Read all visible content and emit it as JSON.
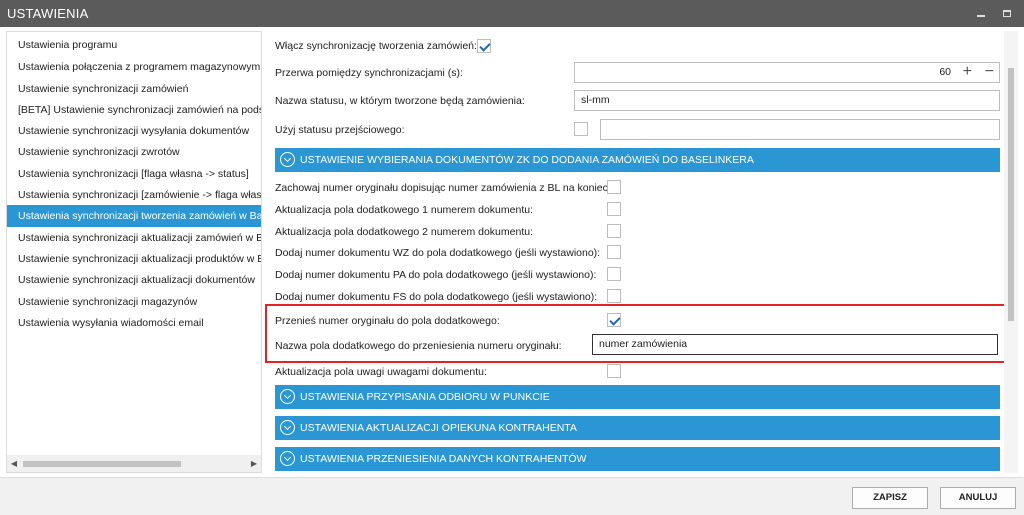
{
  "window": {
    "title": "USTAWIENIA",
    "minimize_icon": "minimize-icon",
    "maximize_icon": "maximize-icon"
  },
  "nav": {
    "items": [
      "Ustawienia programu",
      "Ustawienia połączenia z programem magazynowym",
      "Ustawienie synchronizacji zamówień",
      "[BETA] Ustawienie synchronizacji zamówień na podsta",
      "Ustawienie synchronizacji wysyłania dokumentów",
      "Ustawienie synchronizacji zwrotów",
      "Ustawienia synchronizacji [flaga własna -> status]",
      "Ustawienia synchronizacji [zamówienie -> flaga własn",
      "Ustawienia synchronizacji tworzenia zamówień w Base",
      "Ustawienia synchronizacji aktualizacji zamówień w Bas",
      "Ustawienie synchronizacji aktualizacji produktów w Ba",
      "Ustawienie synchronizacji aktualizacji dokumentów",
      "Ustawienie synchronizacji magazynów",
      "Ustawienia wysyłania wiadomości email"
    ],
    "selected_index": 8,
    "scroll_left_arrow": "◀",
    "scroll_right_arrow": "▶"
  },
  "settings": {
    "enable_sync": {
      "label": "Włącz synchronizację tworzenia zamówień:",
      "checked": true
    },
    "interval": {
      "label": "Przerwa pomiędzy synchronizacjami (s):",
      "value": "60",
      "plus": "+",
      "minus": "−"
    },
    "status_name": {
      "label": "Nazwa statusu, w którym tworzone będą zamówienia:",
      "value": "sl-mm"
    },
    "transitional_status": {
      "label": "Użyj statusu przejściowego:",
      "checked": false,
      "value": ""
    },
    "section_zk": "USTAWIENIE WYBIERANIA DOKUMENTÓW ZK DO DODANIA ZAMÓWIEŃ DO BASELINKERA",
    "options": [
      {
        "label": "Zachowaj numer oryginału dopisując numer zamówienia z BL na koniec:",
        "checked": false
      },
      {
        "label": "Aktualizacja pola dodatkowego 1 numerem dokumentu:",
        "checked": false
      },
      {
        "label": "Aktualizacja pola dodatkowego 2 numerem dokumentu:",
        "checked": false
      },
      {
        "label": "Dodaj numer dokumentu WZ do pola dodatkowego (jeśli wystawiono):",
        "checked": false
      },
      {
        "label": "Dodaj numer dokumentu PA do pola dodatkowego (jeśli wystawiono):",
        "checked": false
      },
      {
        "label": "Dodaj numer dokumentu FS do pola dodatkowego (jeśli wystawiono):",
        "checked": false
      }
    ],
    "move_original": {
      "label": "Przenieś numer oryginału do pola dodatkowego:",
      "checked": true
    },
    "field_name": {
      "label": "Nazwa pola dodatkowego do przeniesienia numeru oryginału:",
      "value": "numer zamówienia"
    },
    "remarks": {
      "label": "Aktualizacja pola uwagi uwagami dokumentu:",
      "checked": false
    },
    "sections": [
      "USTAWIENIA PRZYPISANIA ODBIORU W PUNKCIE",
      "USTAWIENIA AKTUALIZACJI OPIEKUNA KONTRAHENTA",
      "USTAWIENIA PRZENIESIENIA DANYCH KONTRAHENTÓW"
    ]
  },
  "footer": {
    "save": "ZAPISZ",
    "cancel": "ANULUJ"
  },
  "colors": {
    "accent": "#2a97d4",
    "titlebar": "#5b5b5b",
    "highlight": "#e02424"
  }
}
